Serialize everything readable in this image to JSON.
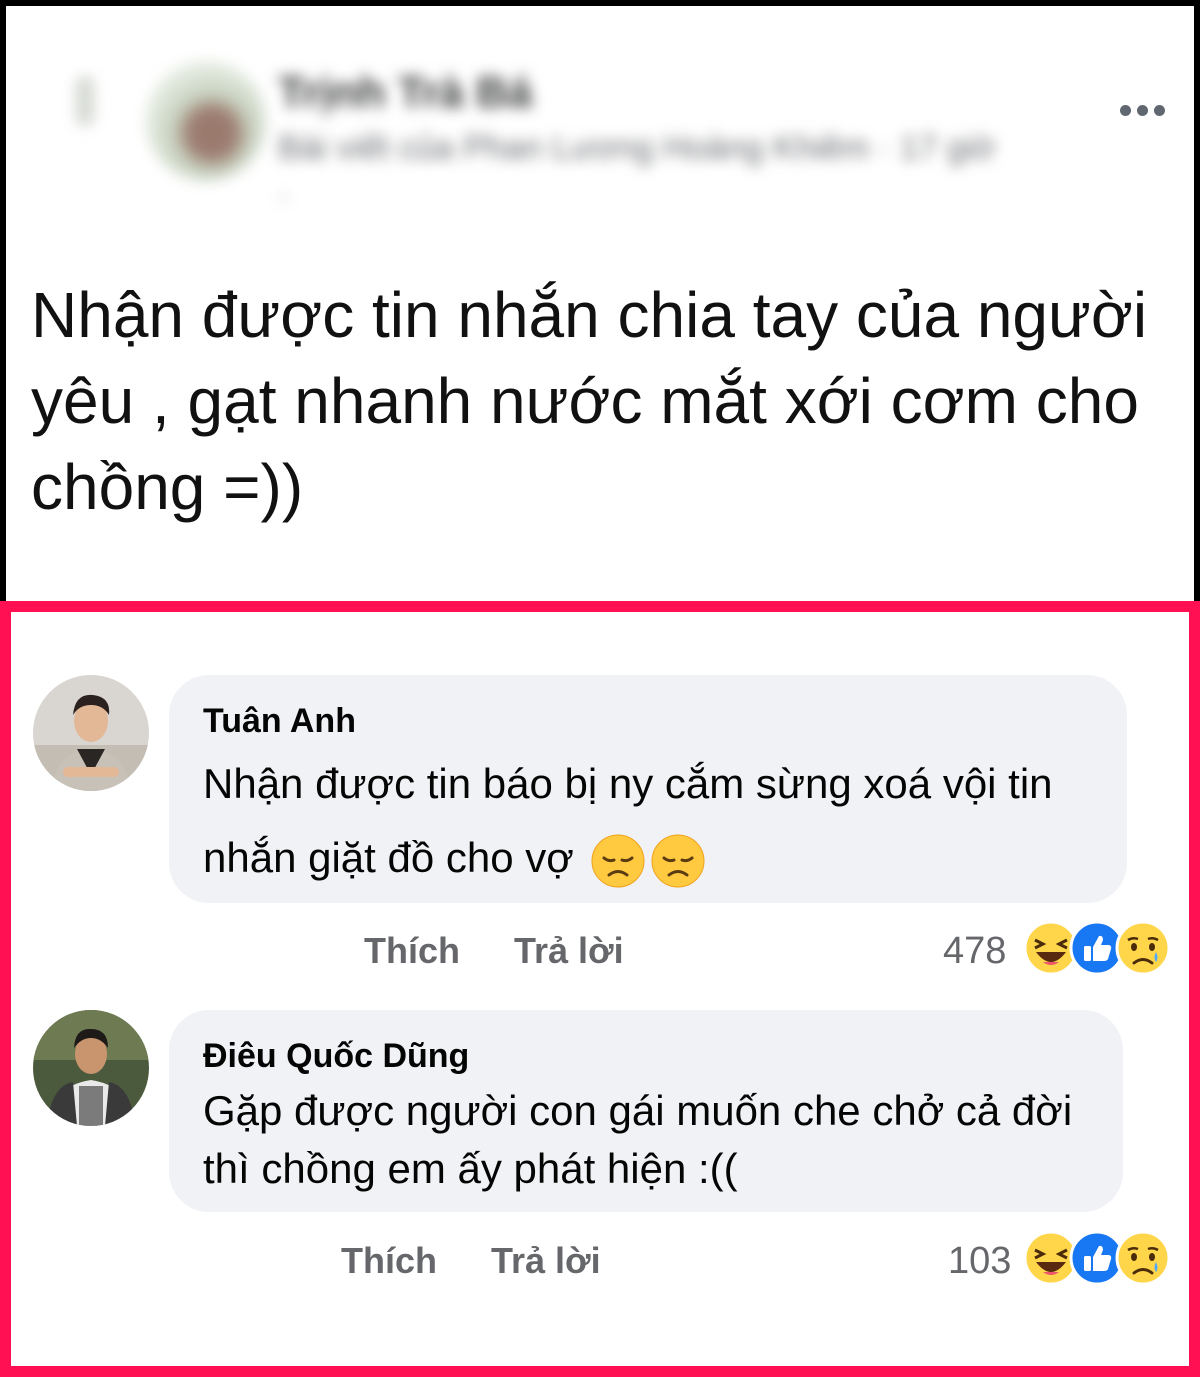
{
  "post": {
    "author": "Trịnh Trà Bá",
    "meta": "Bài viết của Phan Lương Hoàng Khiêm · 17 giờ ·",
    "text": "Nhận được tin nhắn chia tay của người yêu , gạt nhanh nước mắt xới cơm cho chồng =))"
  },
  "comments": [
    {
      "author": "Tuân Anh",
      "text": "Nhận được tin báo bị ny cắm sừng xoá vội tin nhắn giặt đồ cho vợ",
      "emojis": [
        "disappointed-face-icon",
        "disappointed-face-icon"
      ],
      "like_label": "Thích",
      "reply_label": "Trả lời",
      "reaction_count": "478",
      "reactions": [
        "haha-reaction-icon",
        "like-reaction-icon",
        "sad-reaction-icon"
      ]
    },
    {
      "author": "Điêu Quốc Dũng",
      "text": "Gặp được người con gái muốn che chở cả đời thì chồng em ấy phát hiện :((",
      "like_label": "Thích",
      "reply_label": "Trả lời",
      "reaction_count": "103",
      "reactions": [
        "haha-reaction-icon",
        "like-reaction-icon",
        "sad-reaction-icon"
      ]
    }
  ],
  "colors": {
    "highlight_border": "#ff1053",
    "bubble": "#f0f2f5",
    "like_blue": "#1877f2",
    "emoji_yellow": "#ffc940"
  }
}
